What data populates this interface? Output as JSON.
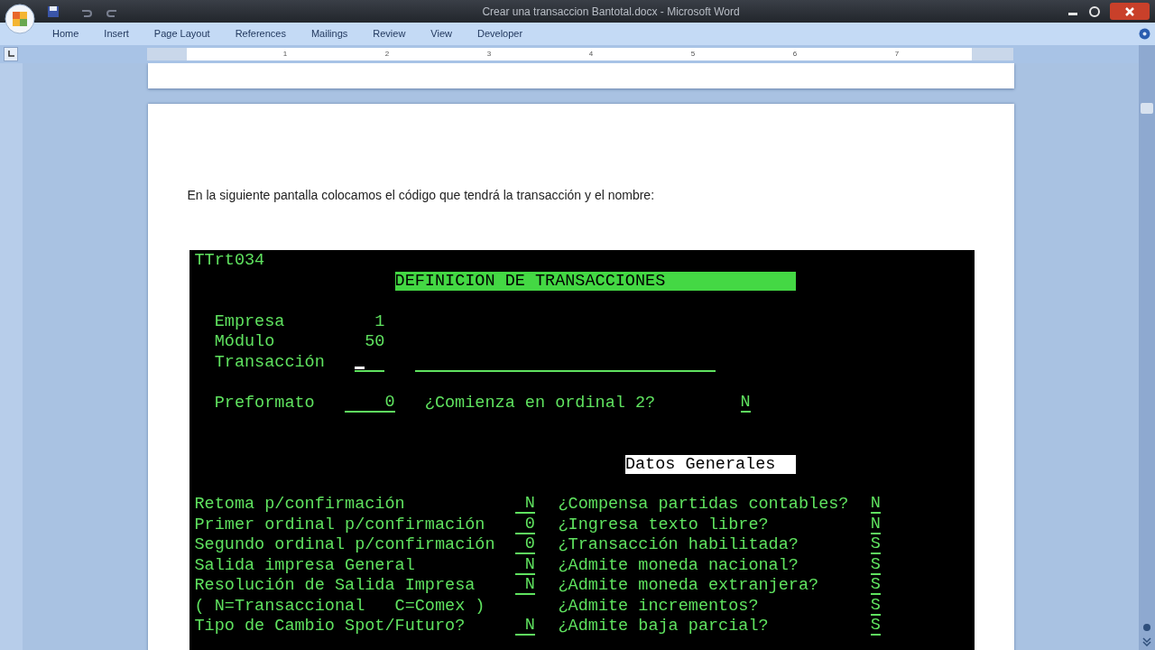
{
  "window": {
    "title": "Crear una transaccion Bantotal.docx - Microsoft Word"
  },
  "ribbon_tabs": [
    "Home",
    "Insert",
    "Page Layout",
    "References",
    "Mailings",
    "Review",
    "View",
    "Developer"
  ],
  "ruler_numbers": [
    "1",
    "2",
    "3",
    "4",
    "5",
    "6",
    "7"
  ],
  "document": {
    "paragraph": "En la siguiente pantalla colocamos el código que tendrá la transacción y el nombre:",
    "terminal": {
      "program_id": "TTrt034",
      "title": "DEFINICION DE TRANSACCIONES",
      "header_fields": [
        {
          "label": "Empresa",
          "value": "1"
        },
        {
          "label": "Módulo",
          "value": "50"
        }
      ],
      "transaccion": {
        "label": "Transacción",
        "cursor": true
      },
      "preformato": {
        "label": "Preformato",
        "value": "0",
        "question": "¿Comienza en ordinal 2?",
        "answer": "N"
      },
      "section_label": "Datos Generales",
      "rows": [
        {
          "left_label": "Retoma p/confirmación",
          "left_value": "N",
          "right_label": "¿Compensa partidas contables?",
          "right_value": "N"
        },
        {
          "left_label": "Primer ordinal p/confirmación",
          "left_value": "0",
          "right_label": "¿Ingresa texto libre?",
          "right_value": "N"
        },
        {
          "left_label": "Segundo ordinal p/confirmación",
          "left_value": "0",
          "right_label": "¿Transacción habilitada?",
          "right_value": "S"
        },
        {
          "left_label": "Salida impresa General",
          "left_value": "N",
          "right_label": "¿Admite moneda nacional?",
          "right_value": "S"
        },
        {
          "left_label": "Resolución de Salida Impresa",
          "left_value": "N",
          "right_label": "¿Admite moneda extranjera?",
          "right_value": "S"
        },
        {
          "left_label": "( N=Transaccional   C=Comex )",
          "right_label": "¿Admite incrementos?",
          "right_value": "S"
        },
        {
          "left_label": "Tipo de Cambio Spot/Futuro?",
          "left_value": "N",
          "right_label": "¿Admite baja parcial?",
          "right_value": "S"
        }
      ]
    }
  }
}
